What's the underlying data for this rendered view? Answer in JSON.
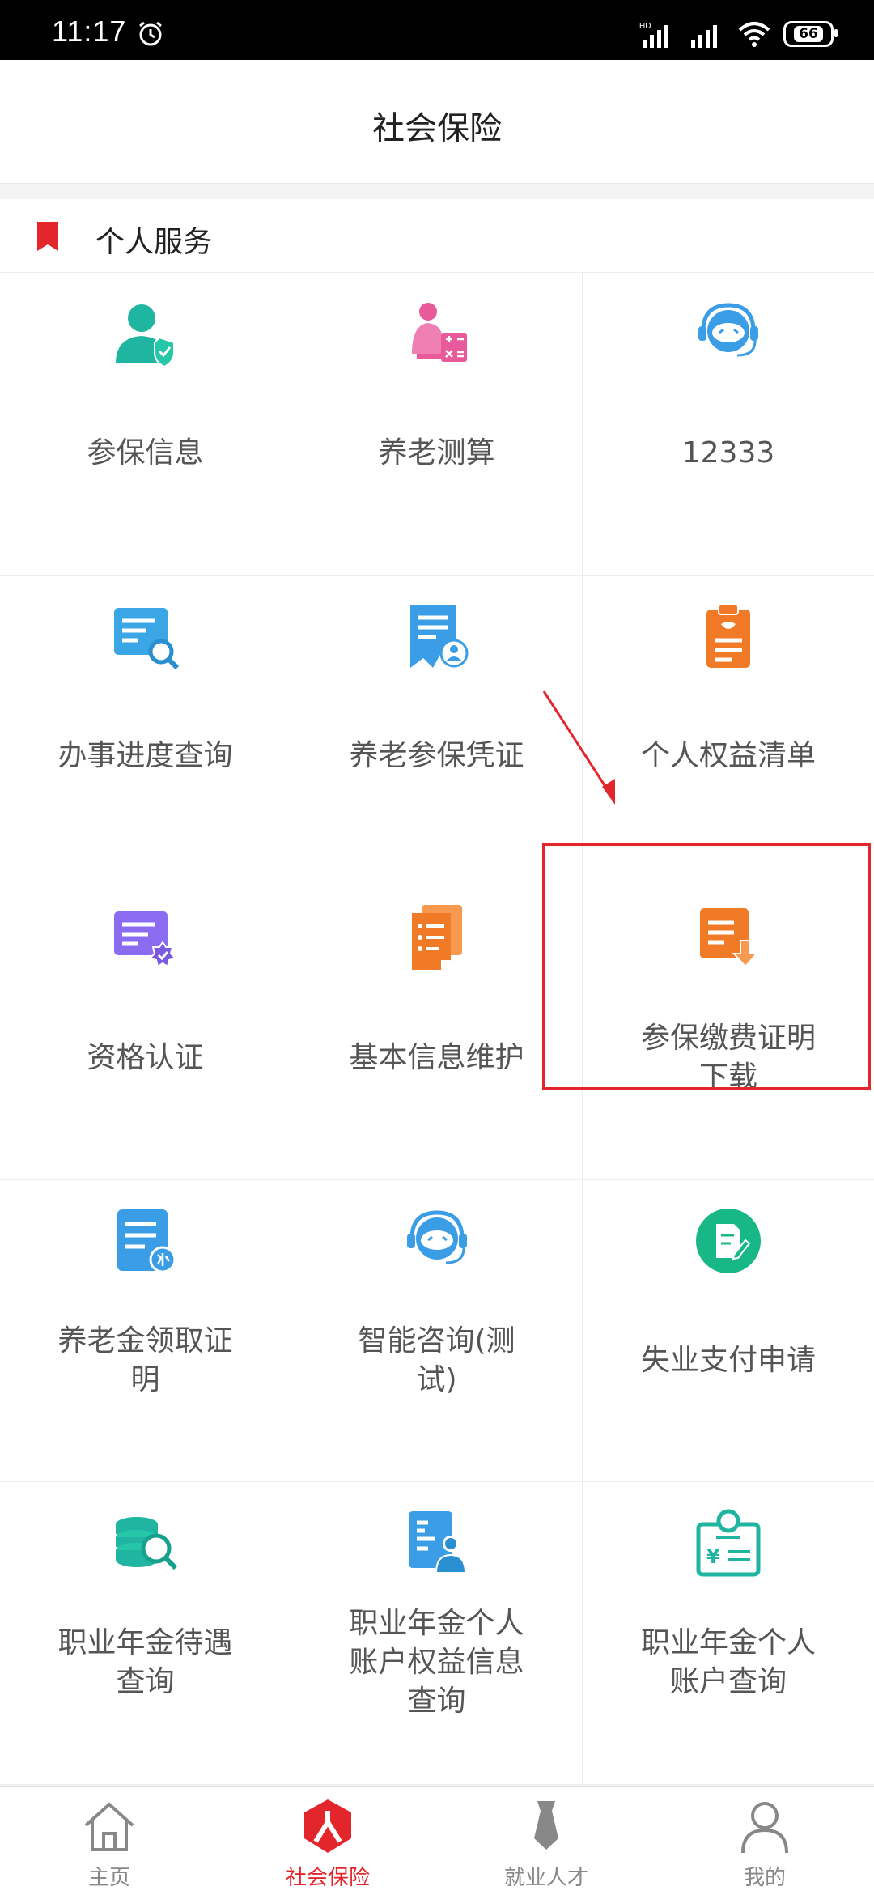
{
  "status_bar": {
    "time": "11:17",
    "battery": "66"
  },
  "header": {
    "title": "社会保险"
  },
  "section": {
    "title": "个人服务"
  },
  "grid": [
    {
      "label": "参保信息",
      "icon": "user-shield-icon"
    },
    {
      "label": "养老测算",
      "icon": "elder-calculator-icon"
    },
    {
      "label": "12333",
      "icon": "robot-headset-icon"
    },
    {
      "label": "办事进度查询",
      "icon": "document-search-icon"
    },
    {
      "label": "养老参保凭证",
      "icon": "document-user-icon"
    },
    {
      "label": "个人权益清单",
      "icon": "clipboard-icon"
    },
    {
      "label": "资格认证",
      "icon": "certificate-check-icon"
    },
    {
      "label": "基本信息维护",
      "icon": "list-document-icon"
    },
    {
      "label": "参保缴费证明下载",
      "icon": "document-download-icon"
    },
    {
      "label": "养老金领取证明",
      "icon": "pension-document-icon"
    },
    {
      "label": "智能咨询(测试)",
      "icon": "robot-headset-icon"
    },
    {
      "label": "失业支付申请",
      "icon": "edit-circle-icon"
    },
    {
      "label": "职业年金待遇查询",
      "icon": "coins-search-icon"
    },
    {
      "label": "职业年金个人账户权益信息查询",
      "icon": "account-user-icon"
    },
    {
      "label": "职业年金个人账户查询",
      "icon": "yuan-card-icon"
    }
  ],
  "bottom_nav": [
    {
      "label": "主页",
      "icon": "home-icon"
    },
    {
      "label": "社会保险",
      "icon": "social-insurance-icon",
      "active": true
    },
    {
      "label": "就业人才",
      "icon": "tie-icon"
    },
    {
      "label": "我的",
      "icon": "person-icon"
    }
  ],
  "colors": {
    "accent": "#e3262b",
    "teal": "#1fb5a0",
    "blue": "#3a9de6",
    "orange": "#f07a26",
    "purple": "#8b6cf0",
    "pink": "#e85a9a",
    "green": "#18b886"
  }
}
